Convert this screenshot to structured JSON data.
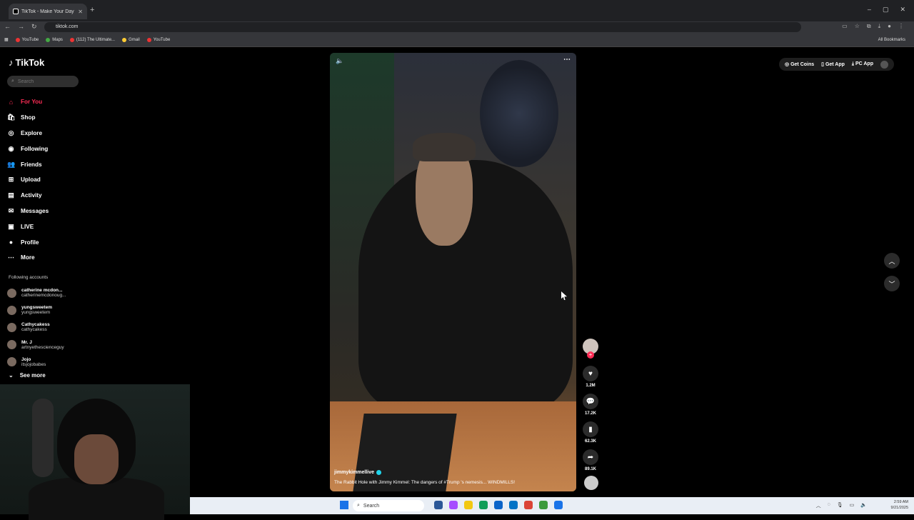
{
  "browser": {
    "tab_title": "TikTok - Make Your Day",
    "new_tab": "+",
    "url": "tiktok.com",
    "window_controls": [
      "–",
      "▢",
      "✕"
    ],
    "bookmarks": [
      {
        "label": "YouTube",
        "color": "#e33"
      },
      {
        "label": "Maps",
        "color": "#4a4"
      },
      {
        "label": "(112) The Ultimate...",
        "color": "#e33"
      },
      {
        "label": "Gmail",
        "color": "#fc3"
      },
      {
        "label": "YouTube",
        "color": "#e33"
      }
    ],
    "all_bookmarks": "All Bookmarks"
  },
  "sidebar": {
    "logo": "TikTok",
    "search_placeholder": "Search",
    "nav": [
      {
        "label": "For You",
        "icon": "home-icon",
        "glyph": "⌂"
      },
      {
        "label": "Shop",
        "icon": "bag-icon",
        "glyph": "🛍"
      },
      {
        "label": "Explore",
        "icon": "compass-icon",
        "glyph": "◎"
      },
      {
        "label": "Following",
        "icon": "following-icon",
        "glyph": "◉"
      },
      {
        "label": "Friends",
        "icon": "friends-icon",
        "glyph": "👥"
      },
      {
        "label": "Upload",
        "icon": "upload-icon",
        "glyph": "⊞"
      },
      {
        "label": "Activity",
        "icon": "activity-icon",
        "glyph": "▤"
      },
      {
        "label": "Messages",
        "icon": "messages-icon",
        "glyph": "✉"
      },
      {
        "label": "LIVE",
        "icon": "live-icon",
        "glyph": "▣"
      },
      {
        "label": "Profile",
        "icon": "profile-icon",
        "glyph": "●"
      },
      {
        "label": "More",
        "icon": "more-icon",
        "glyph": "⋯"
      }
    ],
    "following_title": "Following accounts",
    "following": [
      {
        "name": "catherine mcdon...",
        "handle": "catherinemcdonoug..."
      },
      {
        "name": "yungsweetem",
        "handle": "yungsweetem"
      },
      {
        "name": "Cathycakess",
        "handle": "cathycakess"
      },
      {
        "name": "Mr. J",
        "handle": "artnyethescienceguy"
      },
      {
        "name": "Jojo",
        "handle": "itsjojobabes"
      }
    ],
    "see_more": "See more"
  },
  "video": {
    "author": "jimmykimmellive",
    "caption": "The Rabbit Hole with Jimmy Kimmel: The dangers of #Trump 's nemesis... WINDMILLS!",
    "likes": "1.2M",
    "comments": "17.2K",
    "saves": "62.3K",
    "shares": "89.1K"
  },
  "topbar": {
    "get_coins": "Get Coins",
    "get_app": "Get App",
    "pc_app": "PC App"
  },
  "taskbar": {
    "search": "Search",
    "time": "2:59 AM",
    "date": "9/21/2025"
  },
  "colors": {
    "accent": "#fe2c55",
    "verified": "#20d5ec"
  }
}
